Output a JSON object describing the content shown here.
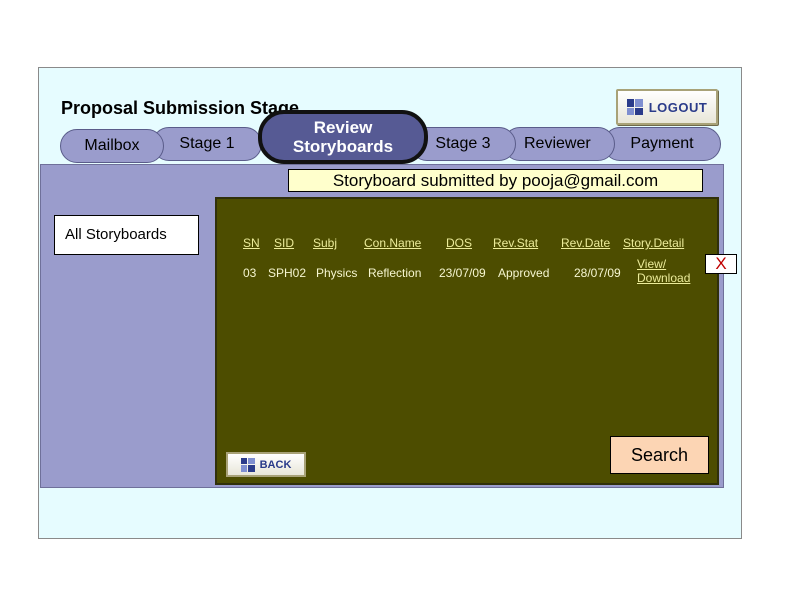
{
  "header": {
    "title": "Proposal Submission Stage",
    "logout_label": "LOGOUT"
  },
  "tabs": {
    "mailbox": "Mailbox",
    "stage1": "Stage 1",
    "review_line1": "Review",
    "review_line2": "Storyboards",
    "stage3": "Stage 3",
    "reviewer": "Reviewer",
    "payment": "Payment"
  },
  "banner": "Storyboard submitted by pooja@gmail.com",
  "sidebar": {
    "all_storyboards": "All Storyboards"
  },
  "table": {
    "columns": [
      "SN",
      "SID",
      "Subj",
      "Con.Name",
      "DOS",
      "Rev.Stat",
      "Rev.Date",
      "Story.Detail"
    ],
    "rows": [
      {
        "sn": "03",
        "sid": "SPH02",
        "subj": "Physics",
        "con_name": "Reflection",
        "dos": "23/07/09",
        "rev_stat": "Approved",
        "rev_date": "28/07/09",
        "detail_line1": "View/",
        "detail_line2": "Download"
      }
    ]
  },
  "buttons": {
    "close": "X",
    "back": "BACK",
    "search": "Search"
  },
  "colors": {
    "tab": "#9a9ccc",
    "active_tab": "#565a94",
    "content_bg": "#4d4d00",
    "banner_bg": "#ffffcc",
    "search_bg": "#fcd5b4"
  }
}
